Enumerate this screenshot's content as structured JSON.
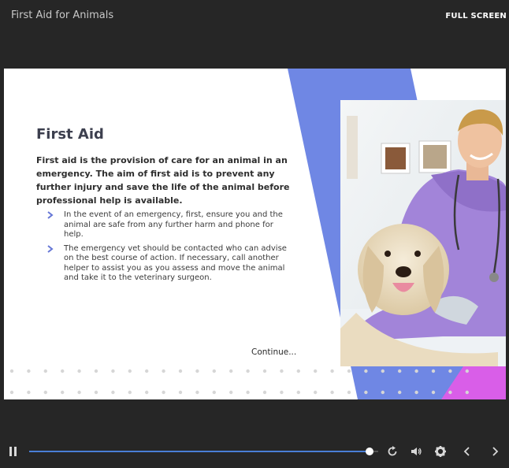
{
  "header": {
    "course_title": "First Aid for Animals",
    "fullscreen_label": "FULL SCREEN"
  },
  "slide": {
    "heading": "First Aid",
    "intro": "First aid is the provision of care for an animal in an emergency. The aim of first aid is to prevent any further injury and save the life of the animal before professional help is available.",
    "bullets": [
      "In the event of an emergency, first, ensure you and the animal are safe from any further harm and phone for help.",
      "The emergency vet should be contacted who can advise on the best course of action. If necessary, call another helper to assist you as you assess and move the animal and take it to the veterinary surgeon."
    ],
    "continue_label": "Continue...",
    "image": "vet-with-golden-retriever-photo"
  },
  "player": {
    "progress": 0.975,
    "icons": [
      "pause-icon",
      "replay-icon",
      "volume-icon",
      "settings-icon",
      "chevron-left-icon",
      "chevron-right-icon"
    ]
  },
  "colors": {
    "background": "#262626",
    "accent_blue": "#6f87e4",
    "accent_pink": "#d95ee8",
    "progress": "#4a7fd6",
    "bullet_chevron": "#6677d6"
  }
}
